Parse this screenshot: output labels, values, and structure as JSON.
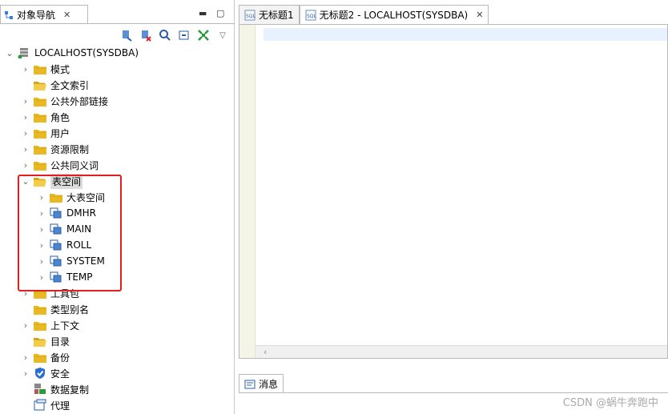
{
  "left_panel": {
    "tab_title": "对象导航",
    "tree": [
      {
        "label": "LOCALHOST(SYSDBA)",
        "level": 0,
        "arrow": "⌄",
        "icon": "server-icon"
      },
      {
        "label": "模式",
        "level": 1,
        "arrow": "›",
        "icon": "folder-icon"
      },
      {
        "label": "全文索引",
        "level": 1,
        "arrow": "",
        "icon": "folder-open-icon"
      },
      {
        "label": "公共外部链接",
        "level": 1,
        "arrow": "›",
        "icon": "folder-icon"
      },
      {
        "label": "角色",
        "level": 1,
        "arrow": "›",
        "icon": "folder-icon"
      },
      {
        "label": "用户",
        "level": 1,
        "arrow": "›",
        "icon": "folder-icon"
      },
      {
        "label": "资源限制",
        "level": 1,
        "arrow": "›",
        "icon": "folder-icon"
      },
      {
        "label": "公共同义词",
        "level": 1,
        "arrow": "›",
        "icon": "folder-icon"
      },
      {
        "label": "表空间",
        "level": 1,
        "arrow": "⌄",
        "icon": "folder-open-icon",
        "selected": true
      },
      {
        "label": "大表空间",
        "level": 2,
        "arrow": "›",
        "icon": "folder-icon"
      },
      {
        "label": "DMHR",
        "level": 2,
        "arrow": "›",
        "icon": "tablespace-icon"
      },
      {
        "label": "MAIN",
        "level": 2,
        "arrow": "›",
        "icon": "tablespace-icon"
      },
      {
        "label": "ROLL",
        "level": 2,
        "arrow": "›",
        "icon": "tablespace-icon"
      },
      {
        "label": "SYSTEM",
        "level": 2,
        "arrow": "›",
        "icon": "tablespace-icon"
      },
      {
        "label": "TEMP",
        "level": 2,
        "arrow": "›",
        "icon": "tablespace-icon"
      },
      {
        "label": "工具包",
        "level": 1,
        "arrow": "›",
        "icon": "folder-icon"
      },
      {
        "label": "类型别名",
        "level": 1,
        "arrow": "",
        "icon": "folder-icon"
      },
      {
        "label": "上下文",
        "level": 1,
        "arrow": "›",
        "icon": "folder-icon"
      },
      {
        "label": "目录",
        "level": 1,
        "arrow": "",
        "icon": "folder-open-icon"
      },
      {
        "label": "备份",
        "level": 1,
        "arrow": "›",
        "icon": "folder-icon"
      },
      {
        "label": "安全",
        "level": 1,
        "arrow": "›",
        "icon": "shield-icon"
      },
      {
        "label": "数据复制",
        "level": 1,
        "arrow": "",
        "icon": "replication-icon"
      },
      {
        "label": "代理",
        "level": 1,
        "arrow": "",
        "icon": "agent-icon"
      }
    ]
  },
  "editor": {
    "tabs": [
      {
        "title": "无标题1",
        "active": false
      },
      {
        "title": "无标题2 - LOCALHOST(SYSDBA)",
        "active": true
      }
    ],
    "scroll_left_glyph": "‹"
  },
  "bottom": {
    "tab_title": "消息"
  },
  "watermark": "CSDN @蜗牛奔跑中",
  "colors": {
    "folder": "#e8b923",
    "highlight_box": "#e0201e",
    "selection": "#dcdcdc"
  }
}
